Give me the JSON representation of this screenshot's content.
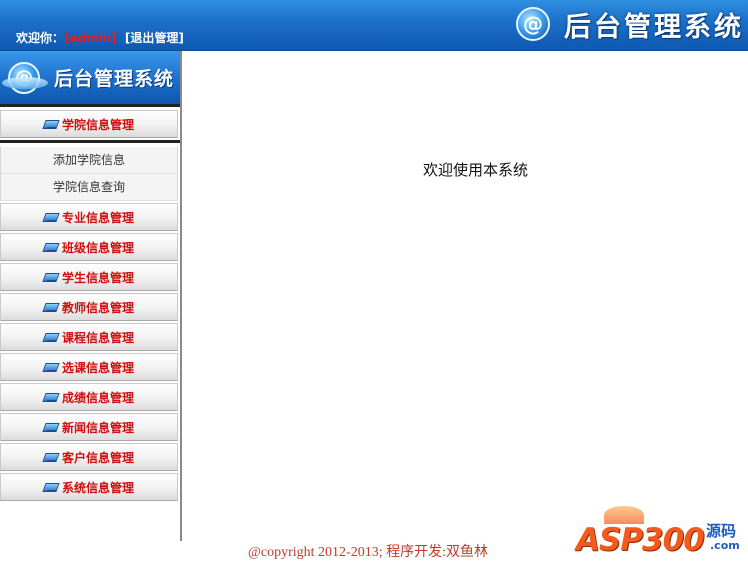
{
  "header": {
    "welcome_prefix": "欢迎你：",
    "username": "[admin]",
    "logout_label": "[退出管理]",
    "title": "后台管理系统"
  },
  "sidebar": {
    "logo_title": "后台管理系统",
    "groups": [
      {
        "label": "学院信息管理",
        "expanded": true,
        "items": [
          "添加学院信息",
          "学院信息查询"
        ]
      },
      {
        "label": "专业信息管理"
      },
      {
        "label": "班级信息管理"
      },
      {
        "label": "学生信息管理"
      },
      {
        "label": "教师信息管理"
      },
      {
        "label": "课程信息管理"
      },
      {
        "label": "选课信息管理"
      },
      {
        "label": "成绩信息管理"
      },
      {
        "label": "新闻信息管理"
      },
      {
        "label": "客户信息管理"
      },
      {
        "label": "系统信息管理"
      }
    ]
  },
  "main": {
    "welcome_text": "欢迎使用本系统"
  },
  "footer": {
    "copyright": "@copyright 2012-2013; 程序开发:双鱼林"
  },
  "watermark": {
    "brand": "ASP300",
    "suffix": "源码",
    "domain": ".com"
  },
  "colors": {
    "header_blue": "#1b6fc8",
    "menu_label_red": "#d01010",
    "username_red": "#e81c1c",
    "copyright_red": "#c0392b",
    "watermark_orange": "#f35a1c"
  }
}
